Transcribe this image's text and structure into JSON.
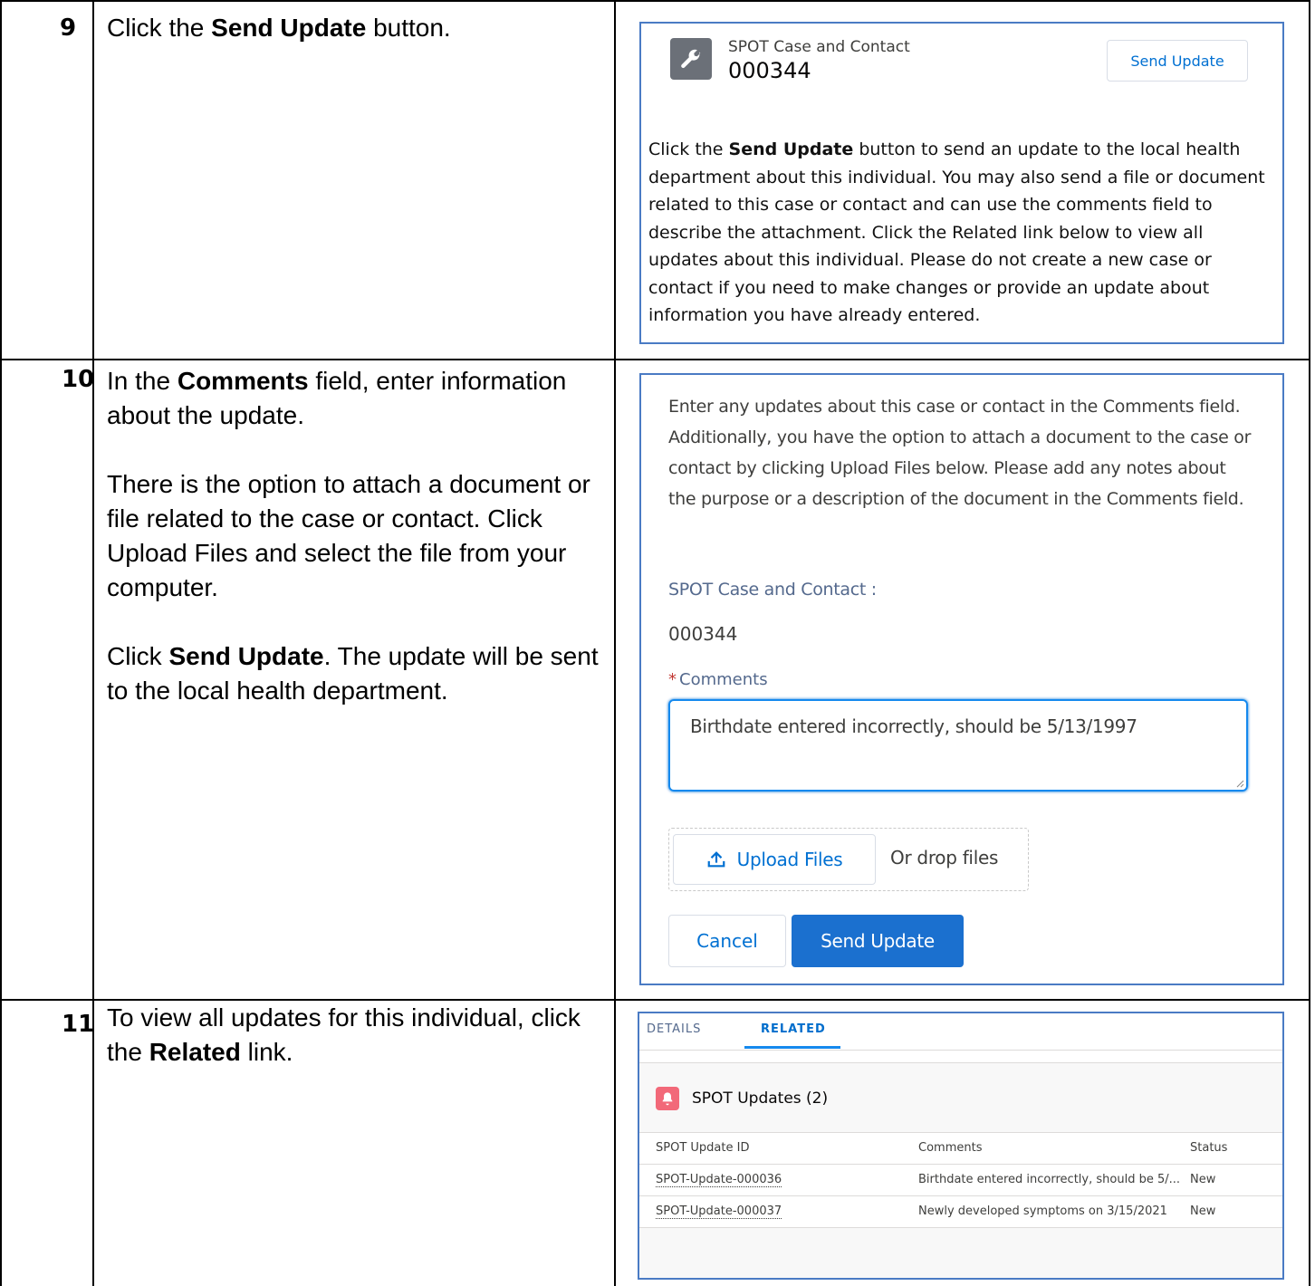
{
  "steps": [
    {
      "number": "9",
      "instruction": {
        "pre": "Click the ",
        "bold": "Send Update",
        "post": " button."
      }
    },
    {
      "number": "10",
      "instruction": {
        "p1_pre": "In the ",
        "p1_bold": "Comments",
        "p1_post": " field, enter information about the update.",
        "p2": "There is the option to attach a document or file related to the case or contact. Click Upload Files and select the file from your computer.",
        "p3_pre": "Click ",
        "p3_bold": "Send Update",
        "p3_post": ". The update will be sent to the local health department."
      }
    },
    {
      "number": "11",
      "instruction": {
        "pre": "To view all updates for this individual, click the ",
        "bold": "Related",
        "post": " link."
      }
    }
  ],
  "panel1": {
    "icon": "wrench-icon",
    "object_label": "SPOT Case and Contact",
    "record_number": "000344",
    "send_update_label": "Send Update",
    "desc_pre": "Click the ",
    "desc_bold": "Send Update",
    "desc_post": " button to send an update to the local health department about this individual. You may also send a file or document related to this case or contact and can use the comments field to describe the attachment. Click the Related link below to view all updates about this individual. Please do not create a new case or contact if you need to make changes or provide an update about information you have already entered."
  },
  "panel2": {
    "intro": "Enter any updates about this case or contact in the Comments field. Additionally, you have the option to attach a document to the case or contact by clicking Upload Files below. Please add any notes about the purpose or a description of the document in the Comments field.",
    "case_label": "SPOT Case and Contact :",
    "case_value": "000344",
    "required_mark": "*",
    "comments_label": "Comments",
    "comments_value": "Birthdate entered incorrectly, should be 5/13/1997",
    "upload_label": "Upload Files",
    "drop_label": "Or drop files",
    "cancel_label": "Cancel",
    "send_label": "Send Update"
  },
  "panel3": {
    "tabs": {
      "details": "DETAILS",
      "related": "RELATED"
    },
    "card_title": "SPOT Updates (2)",
    "card_icon": "bell-icon",
    "columns": [
      "SPOT Update ID",
      "Comments",
      "Status"
    ],
    "rows": [
      {
        "id": "SPOT-Update-000036",
        "comments": "Birthdate entered incorrectly, should be 5/...",
        "status": "New"
      },
      {
        "id": "SPOT-Update-000037",
        "comments": "Newly developed symptoms on 3/15/2021",
        "status": "New"
      }
    ]
  },
  "colors": {
    "accent": "#0070d2",
    "panel_border": "#4a7bc4",
    "primary_button": "#1b70cf",
    "card_icon": "#f26979"
  }
}
